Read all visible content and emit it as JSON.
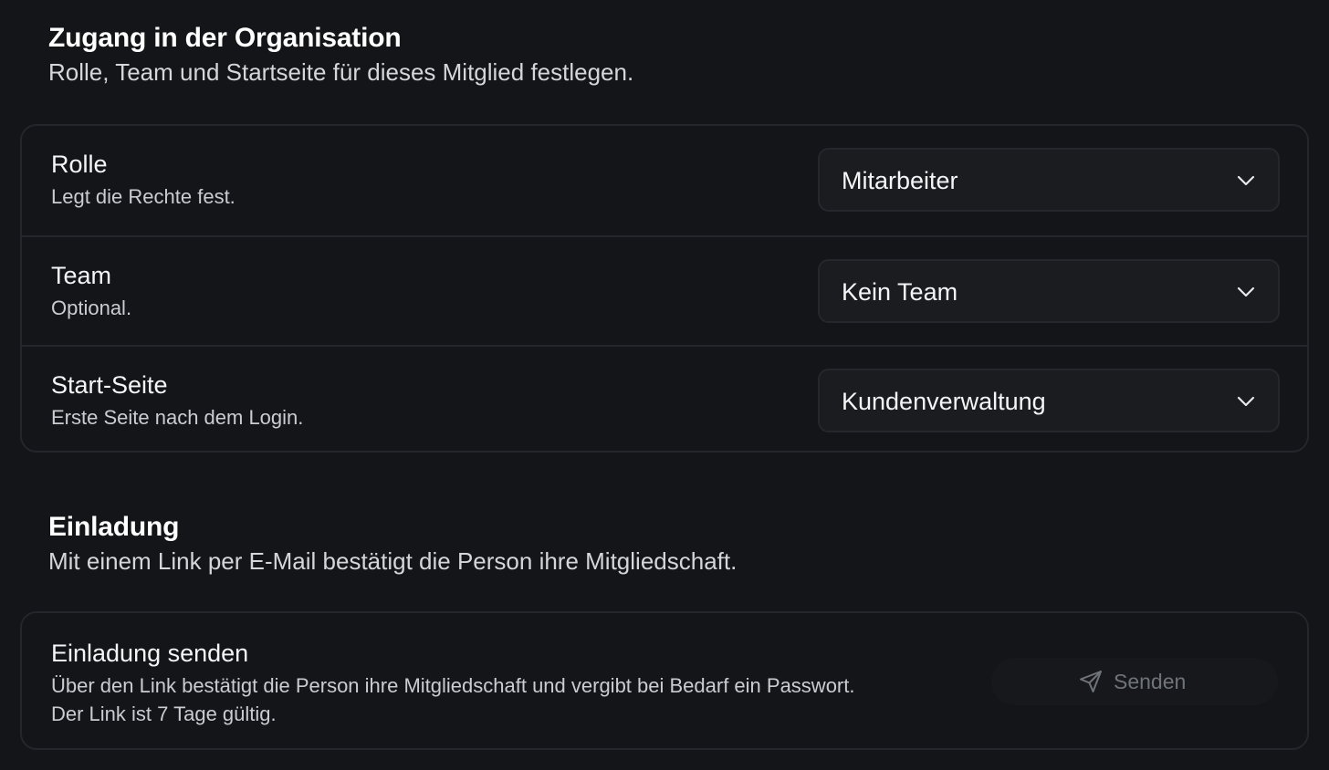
{
  "access": {
    "title": "Zugang in der Organisation",
    "subtitle": "Rolle, Team und Startseite für dieses Mitglied festlegen.",
    "rows": [
      {
        "label": "Rolle",
        "help": "Legt die Rechte fest.",
        "value": "Mitarbeiter",
        "icon": "chevron-down-icon"
      },
      {
        "label": "Team",
        "help": "Optional.",
        "value": "Kein Team",
        "icon": "chevron-down-icon"
      },
      {
        "label": "Start-Seite",
        "help": "Erste Seite nach dem Login.",
        "value": "Kundenverwaltung",
        "icon": "chevron-down-icon"
      }
    ]
  },
  "invitation": {
    "title": "Einladung",
    "subtitle": "Mit einem Link per E-Mail bestätigt die Person ihre Mitgliedschaft.",
    "card": {
      "label": "Einladung senden",
      "line1": "Über den Link bestätigt die Person ihre Mitgliedschaft und vergibt bei Bedarf ein Passwort.",
      "line2": "Der Link ist 7 Tage gültig.",
      "button_label": "Senden",
      "button_icon": "send-icon",
      "button_state": "disabled"
    }
  },
  "colors": {
    "background": "#141518",
    "card_border": "#24262b",
    "select_background": "#1b1c20",
    "disabled_text": "#6f737a"
  }
}
